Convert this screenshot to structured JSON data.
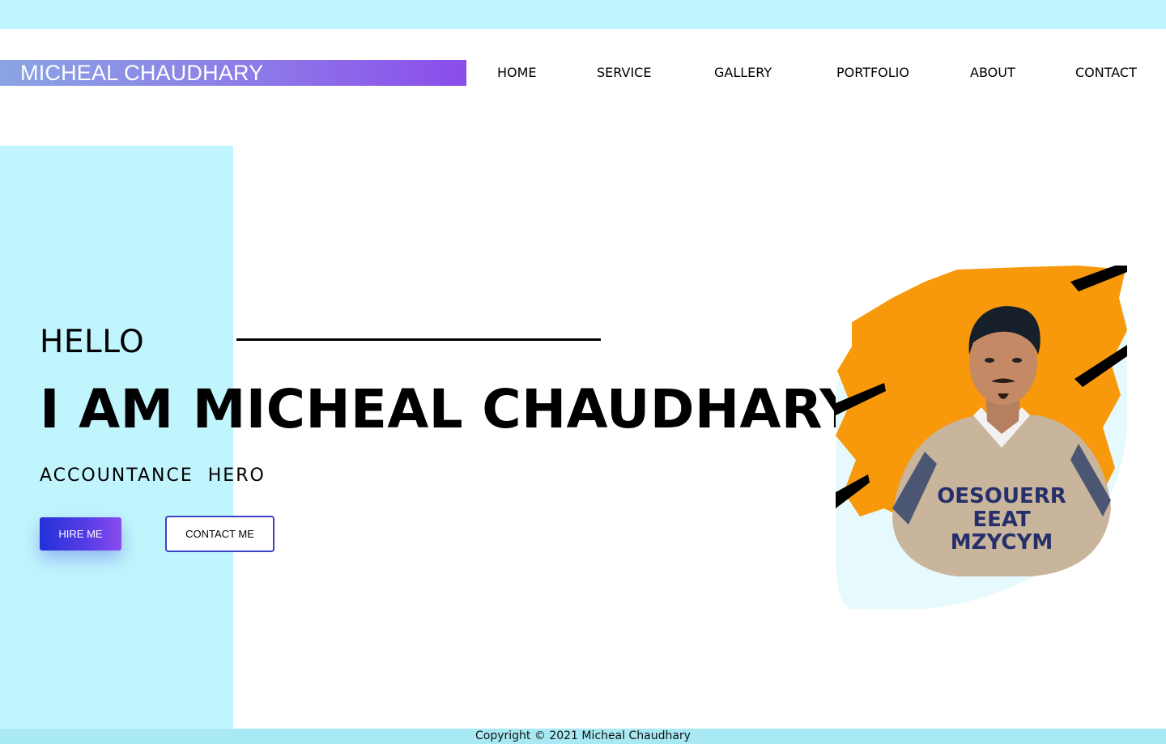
{
  "brand": {
    "name": "MICHEAL CHAUDHARY"
  },
  "nav": {
    "items": [
      {
        "label": "HOME"
      },
      {
        "label": "SERVICE"
      },
      {
        "label": "GALLERY"
      },
      {
        "label": "PORTFOLIO"
      },
      {
        "label": "ABOUT"
      },
      {
        "label": "CONTACT"
      }
    ]
  },
  "hero": {
    "greeting": "HELLO",
    "headline": "I AM MICHEAL CHAUDHARY",
    "subtitle": "ACCOUNTANCE  HERO",
    "hire_label": "HIRE ME",
    "contact_label": "CONTACT ME",
    "portrait_sweater_text": [
      "OESOUERR",
      "EEAT",
      "MZYCYM"
    ]
  },
  "footer": {
    "copyright": "Copyright © 2021 Micheal Chaudhary"
  },
  "colors": {
    "accent_cyan": "#c1f5fd",
    "brand_gradient_start": "#8aa4e4",
    "brand_gradient_end": "#8b4ceb",
    "button_gradient_start": "#2430d9",
    "button_border": "#3b44c7",
    "splash_orange": "#f7990b"
  }
}
